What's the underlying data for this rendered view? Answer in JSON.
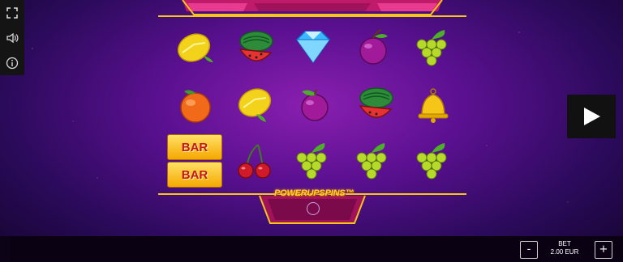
{
  "side_menu": {
    "items": [
      {
        "icon": "fullscreen-icon"
      },
      {
        "icon": "sound-icon"
      },
      {
        "icon": "info-icon"
      }
    ]
  },
  "reels": [
    [
      "lemon",
      "watermelon",
      "diamond",
      "plum",
      "grapes"
    ],
    [
      "orange",
      "lemon",
      "plum",
      "watermelon",
      "bell"
    ],
    [
      "bar",
      "cherries",
      "grapes",
      "grapes",
      "grapes"
    ]
  ],
  "bar_symbol": {
    "label": "BAR"
  },
  "logo": {
    "text": "POWERUPSPINS™"
  },
  "bet": {
    "label": "BET",
    "value": "2.00 EUR",
    "minus": "-",
    "plus": "+"
  },
  "colors": {
    "frame_gold": "#f5c518",
    "frame_pink": "#e01a7a",
    "bg_purple": "#5a1090"
  }
}
